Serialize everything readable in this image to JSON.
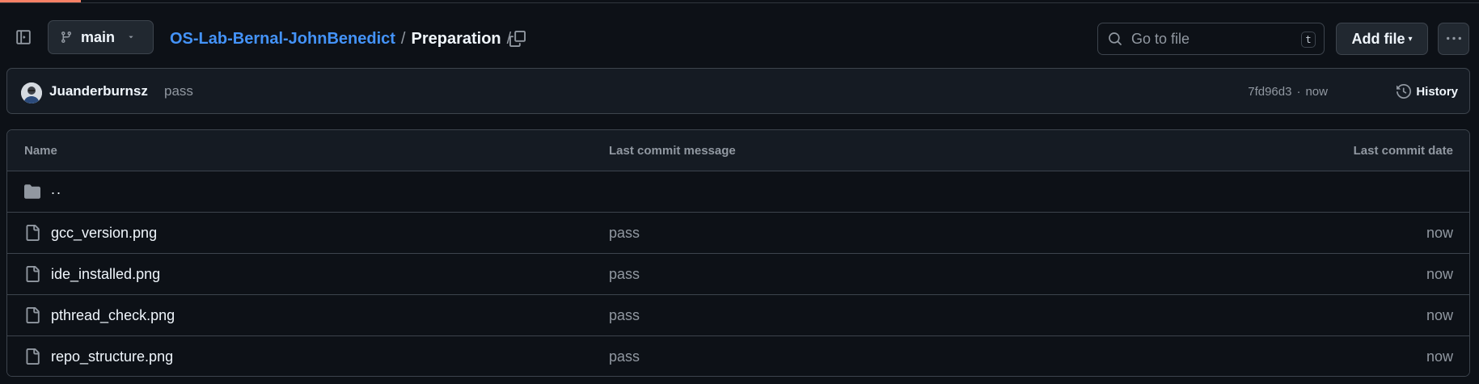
{
  "branch": {
    "name": "main"
  },
  "breadcrumb": {
    "repo": "OS-Lab-Bernal-JohnBenedict",
    "separator": "/",
    "current": "Preparation",
    "trailing": "/"
  },
  "search": {
    "placeholder": "Go to file",
    "shortcut": "t"
  },
  "toolbar": {
    "add_file_label": "Add file"
  },
  "commit": {
    "author": "Juanderburnsz",
    "message": "pass",
    "sha": "7fd96d3",
    "dot": "·",
    "time": "now",
    "history_label": "History"
  },
  "table": {
    "headers": {
      "name": "Name",
      "message": "Last commit message",
      "date": "Last commit date"
    },
    "parent_label": "..",
    "rows": [
      {
        "name": "gcc_version.png",
        "message": "pass",
        "date": "now"
      },
      {
        "name": "ide_installed.png",
        "message": "pass",
        "date": "now"
      },
      {
        "name": "pthread_check.png",
        "message": "pass",
        "date": "now"
      },
      {
        "name": "repo_structure.png",
        "message": "pass",
        "date": "now"
      }
    ]
  },
  "colors": {
    "background": "#0d1117",
    "link": "#4493f8",
    "border": "#3d444d",
    "accent": "#f78166"
  },
  "icons": [
    "sidebar-icon",
    "git-branch-icon",
    "chevron-down-icon",
    "copy-icon",
    "search-icon",
    "kebab-icon",
    "history-icon",
    "folder-icon",
    "file-icon"
  ]
}
